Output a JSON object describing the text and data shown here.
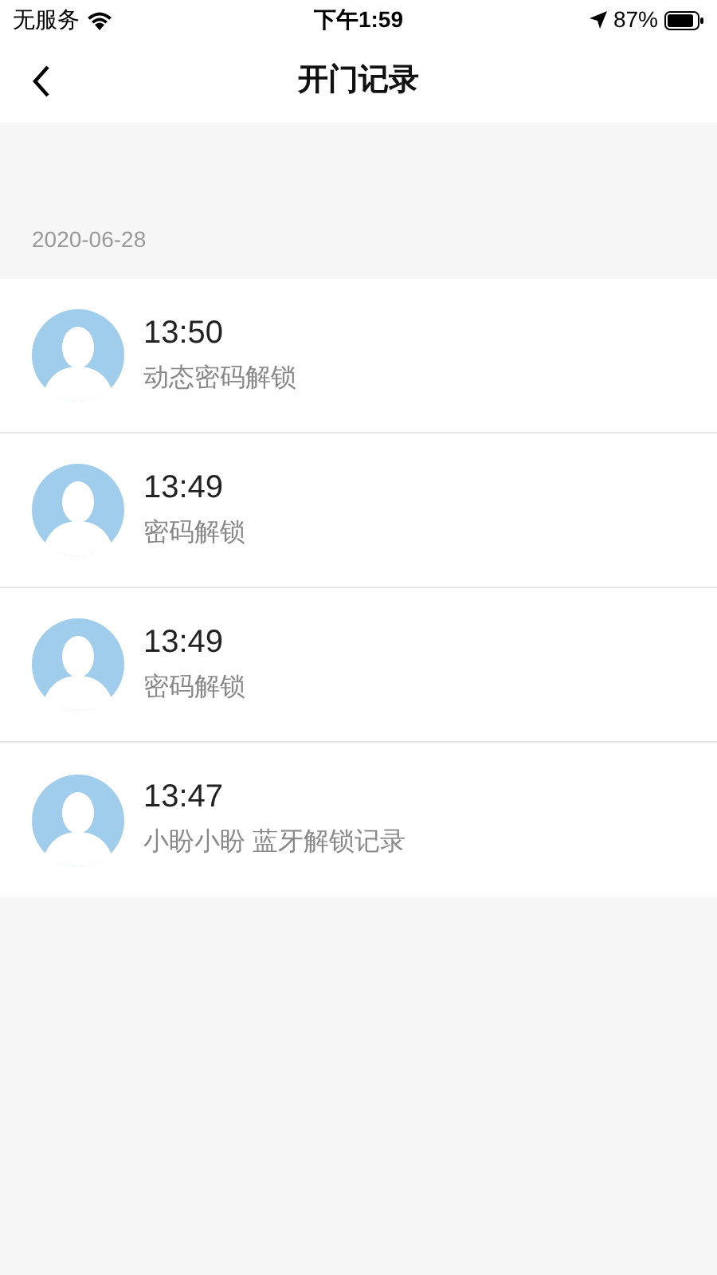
{
  "status_bar": {
    "carrier": "无服务",
    "time": "下午1:59",
    "battery": "87%"
  },
  "nav": {
    "title": "开门记录"
  },
  "date": "2020-06-28",
  "records": [
    {
      "time": "13:50",
      "description": "动态密码解锁"
    },
    {
      "time": "13:49",
      "description": "密码解锁"
    },
    {
      "time": "13:49",
      "description": "密码解锁"
    },
    {
      "time": "13:47",
      "description": "小盼小盼 蓝牙解锁记录"
    }
  ]
}
